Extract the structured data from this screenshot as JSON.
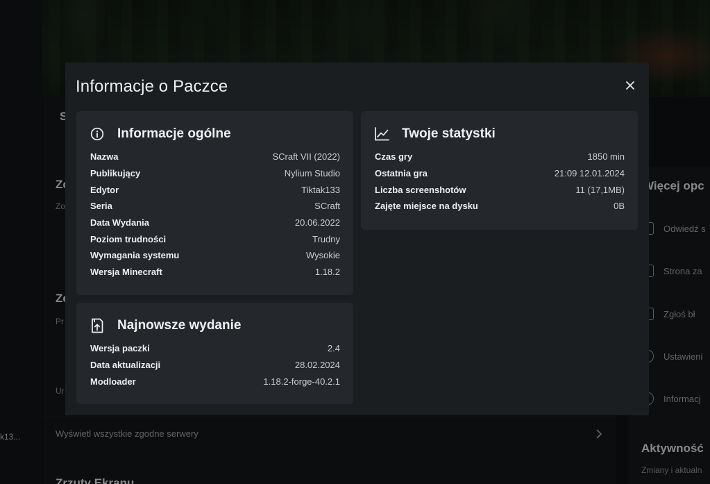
{
  "background": {
    "side_text": "k13...",
    "main_titles": [
      "S",
      "Zo",
      "Ze"
    ],
    "main_subs": [
      "Zo",
      "Pr",
      "Ur"
    ],
    "servers_link": "Wyświetl wszystkie zgodne serwery",
    "right_panel": {
      "title": "Więcej opc",
      "items": [
        "Odwiedź s",
        "Strona za",
        "Zgłoś bł",
        "Ustawieni",
        "Informacj"
      ]
    },
    "right_panel2": {
      "title": "Aktywność",
      "sub": "Zmiany i aktualn"
    },
    "bottom_title": "Zrzuty Ekranu"
  },
  "modal": {
    "title": "Informacje o Paczce",
    "close_icon": "close-icon",
    "general": {
      "icon": "info-circle-icon",
      "title": "Informacje ogólne",
      "rows": [
        {
          "key": "Nazwa",
          "value": "SCraft VII (2022)"
        },
        {
          "key": "Publikujący",
          "value": "Nylium Studio"
        },
        {
          "key": "Edytor",
          "value": "Tiktak133"
        },
        {
          "key": "Seria",
          "value": "SCraft"
        },
        {
          "key": "Data Wydania",
          "value": "20.06.2022"
        },
        {
          "key": "Poziom trudności",
          "value": "Trudny"
        },
        {
          "key": "Wymagania systemu",
          "value": "Wysokie"
        },
        {
          "key": "Wersja Minecraft",
          "value": "1.18.2"
        }
      ]
    },
    "latest": {
      "icon": "package-upload-icon",
      "title": "Najnowsze wydanie",
      "rows": [
        {
          "key": "Wersja paczki",
          "value": "2.4"
        },
        {
          "key": "Data aktualizacji",
          "value": "28.02.2024"
        },
        {
          "key": "Modloader",
          "value": "1.18.2-forge-40.2.1"
        }
      ]
    },
    "stats": {
      "icon": "line-chart-icon",
      "title": "Twoje statystki",
      "rows": [
        {
          "key": "Czas gry",
          "value": "1850 min"
        },
        {
          "key": "Ostatnia gra",
          "value": "21:09 12.01.2024"
        },
        {
          "key": "Liczba screenshotów",
          "value": "11 (17,1MB)"
        },
        {
          "key": "Zajęte miejsce na dysku",
          "value": "0B"
        }
      ]
    }
  }
}
